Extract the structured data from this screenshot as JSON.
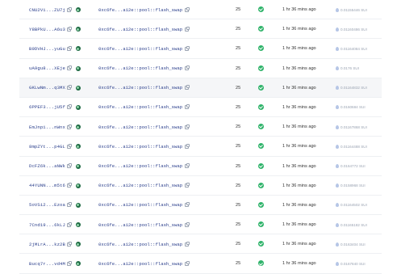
{
  "rows": [
    {
      "sender": "CNU2Vi...ZU7j",
      "method": "0xc6fe...a12e::pool::flash_swap",
      "amount": "25",
      "time": "1 hr 36 mins ago",
      "fee": "0.01155446 SUI",
      "highlight": false
    },
    {
      "sender": "Y8BPkU...A6u3",
      "method": "0xc6fe...a12e::pool::flash_swap",
      "amount": "25",
      "time": "1 hr 36 mins ago",
      "fee": "0.01160486 SUI",
      "highlight": false
    },
    {
      "sender": "B9DVHJ...yuGu",
      "method": "0xc6fe...a12e::pool::flash_swap",
      "amount": "25",
      "time": "1 hr 36 mins ago",
      "fee": "0.01164084 SUI",
      "highlight": false
    },
    {
      "sender": "uA9gu8...XEje",
      "method": "0xc6fe...a12e::pool::flash_swap",
      "amount": "25",
      "time": "1 hr 36 mins ago",
      "fee": "0.0176 SUI",
      "highlight": false
    },
    {
      "sender": "GKLwNm...q3MX",
      "method": "0xc6fe...a12e::pool::flash_swap",
      "amount": "25",
      "time": "1 hr 36 mins ago",
      "fee": "0.01164832 SUI",
      "highlight": true
    },
    {
      "sender": "6PPEF3...jU5f",
      "method": "0xc6fe...a12e::pool::flash_swap",
      "amount": "25",
      "time": "1 hr 36 mins ago",
      "fee": "0.0160684 SUI",
      "highlight": false
    },
    {
      "sender": "EmJnpi...nWnx",
      "method": "0xc6fe...a12e::pool::flash_swap",
      "amount": "25",
      "time": "1 hr 36 mins ago",
      "fee": "0.01167868 SUI",
      "highlight": false
    },
    {
      "sender": "8mpZYt...p4GL",
      "method": "0xc6fe...a12e::pool::flash_swap",
      "amount": "25",
      "time": "1 hr 36 mins ago",
      "fee": "0.01164488 SUI",
      "highlight": false
    },
    {
      "sender": "DcFZ6k...aNWk",
      "method": "0xc6fe...a12e::pool::flash_swap",
      "amount": "25",
      "time": "1 hr 36 mins ago",
      "fee": "0.0164772 SUI",
      "highlight": false
    },
    {
      "sender": "44YUNN...m5t6",
      "method": "0xc6fe...a12e::pool::flash_swap",
      "amount": "25",
      "time": "1 hr 36 mins ago",
      "fee": "0.0158968 SUI",
      "highlight": false
    },
    {
      "sender": "5oVSi2...Ezoa",
      "method": "0xc6fe...a12e::pool::flash_swap",
      "amount": "25",
      "time": "1 hr 36 mins ago",
      "fee": "0.01164502 SUI",
      "highlight": false
    },
    {
      "sender": "7Cnd19...6kLJ",
      "method": "0xc6fe...a12e::pool::flash_swap",
      "amount": "25",
      "time": "1 hr 36 mins ago",
      "fee": "0.01165182 SUI",
      "highlight": false
    },
    {
      "sender": "2jMLrA...kz2B",
      "method": "0xc6fe...a12e::pool::flash_swap",
      "amount": "25",
      "time": "1 hr 36 mins ago",
      "fee": "0.0163404 SUI",
      "highlight": false
    },
    {
      "sender": "Bucq7r...vd4M",
      "method": "0xc6fe...a12e::pool::flash_swap",
      "amount": "25",
      "time": "1 hr 36 mins ago",
      "fee": "0.0167840 SUI",
      "highlight": false
    }
  ]
}
